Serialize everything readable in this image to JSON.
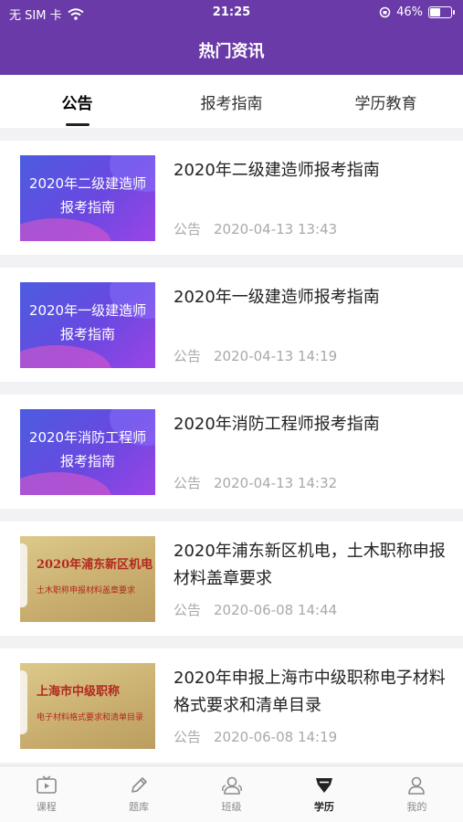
{
  "status": {
    "carrier": "无 SIM 卡",
    "time": "21:25",
    "battery": "46%",
    "battery_level": 0.46
  },
  "header": {
    "title": "热门资讯"
  },
  "tabs": [
    {
      "label": "公告",
      "active": true
    },
    {
      "label": "报考指南",
      "active": false
    },
    {
      "label": "学历教育",
      "active": false
    }
  ],
  "articles": [
    {
      "thumb": {
        "style": "purple",
        "line1": "2020年二级建造师",
        "line2": "报考指南"
      },
      "title": "2020年二级建造师报考指南",
      "category": "公告",
      "date": "2020-04-13 13:43"
    },
    {
      "thumb": {
        "style": "purple",
        "line1": "2020年一级建造师",
        "line2": "报考指南"
      },
      "title": "2020年一级建造师报考指南",
      "category": "公告",
      "date": "2020-04-13 14:19"
    },
    {
      "thumb": {
        "style": "purple",
        "line1": "2020年消防工程师",
        "line2": "报考指南"
      },
      "title": "2020年消防工程师报考指南",
      "category": "公告",
      "date": "2020-04-13 14:32"
    },
    {
      "thumb": {
        "style": "gold",
        "line1": "2020年浦东新区机电",
        "line2": "土木职称申报材料盖章要求"
      },
      "title": "2020年浦东新区机电，土木职称申报材料盖章要求",
      "category": "公告",
      "date": "2020-06-08 14:44"
    },
    {
      "thumb": {
        "style": "gold",
        "line1": "上海市中级职称",
        "line2": "电子材料格式要求和清单目录"
      },
      "title": "2020年申报上海市中级职称电子材料格式要求和清单目录",
      "category": "公告",
      "date": "2020-06-08 14:19"
    }
  ],
  "bottom_nav": [
    {
      "label": "课程",
      "icon": "tv-icon",
      "active": false
    },
    {
      "label": "题库",
      "icon": "pencil-icon",
      "active": false
    },
    {
      "label": "班级",
      "icon": "group-icon",
      "active": false
    },
    {
      "label": "学历",
      "icon": "gem-icon",
      "active": true
    },
    {
      "label": "我的",
      "icon": "user-icon",
      "active": false
    }
  ],
  "colors": {
    "header_bg": "#6a3aa8",
    "active_text": "#222222",
    "meta_text": "#a9a9ad"
  }
}
